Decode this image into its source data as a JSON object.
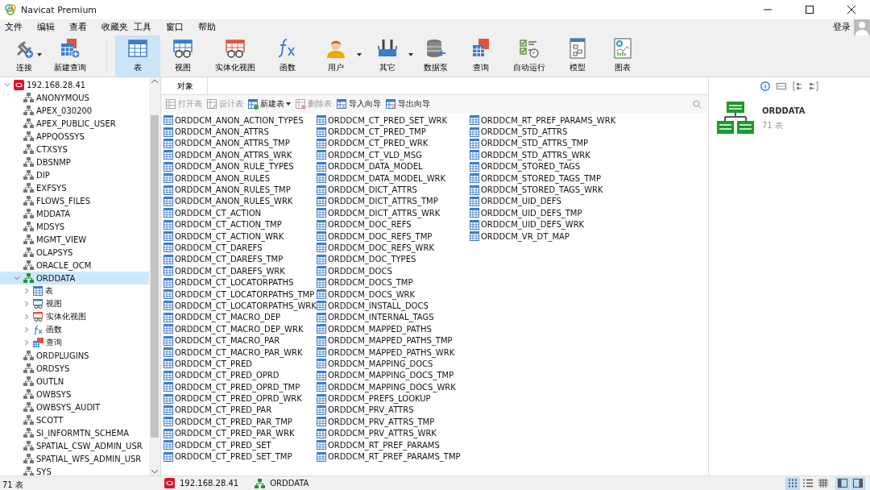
{
  "window": {
    "title": "Navicat Premium"
  },
  "menu": [
    "文件",
    "编辑",
    "查看",
    "收藏夹",
    "工具",
    "窗口",
    "帮助"
  ],
  "login": "登录",
  "toolbar": [
    {
      "label": "连接",
      "kind": "connect",
      "dropdown": true,
      "selected": false
    },
    {
      "label": "新建查询",
      "kind": "newquery",
      "dropdown": false,
      "selected": false
    },
    {
      "label": "表",
      "kind": "table",
      "dropdown": false,
      "selected": true
    },
    {
      "label": "视图",
      "kind": "view",
      "dropdown": false,
      "selected": false
    },
    {
      "label": "实体化视图",
      "kind": "matview",
      "dropdown": false,
      "selected": false
    },
    {
      "label": "函数",
      "kind": "function",
      "dropdown": false,
      "selected": false
    },
    {
      "label": "用户",
      "kind": "user",
      "dropdown": true,
      "selected": false
    },
    {
      "label": "其它",
      "kind": "tools",
      "dropdown": true,
      "selected": false
    },
    {
      "label": "数据泵",
      "kind": "pump",
      "dropdown": false,
      "selected": false
    },
    {
      "label": "查询",
      "kind": "query",
      "dropdown": false,
      "selected": false
    },
    {
      "label": "自动运行",
      "kind": "auto",
      "dropdown": false,
      "selected": false
    },
    {
      "label": "模型",
      "kind": "model",
      "dropdown": false,
      "selected": false
    },
    {
      "label": "图表",
      "kind": "chart",
      "dropdown": false,
      "selected": false
    }
  ],
  "tree": {
    "label": "192.168.28.41",
    "expanded": true,
    "children": [
      {
        "label": "ANONYMOUS",
        "kind": "schema",
        "selected": false
      },
      {
        "label": "APEX_030200",
        "kind": "schema",
        "selected": false
      },
      {
        "label": "APEX_PUBLIC_USER",
        "kind": "schema",
        "selected": false
      },
      {
        "label": "APPQOSSYS",
        "kind": "schema",
        "selected": false
      },
      {
        "label": "CTXSYS",
        "kind": "schema",
        "selected": false
      },
      {
        "label": "DBSNMP",
        "kind": "schema",
        "selected": false
      },
      {
        "label": "DIP",
        "kind": "schema",
        "selected": false
      },
      {
        "label": "EXFSYS",
        "kind": "schema",
        "selected": false
      },
      {
        "label": "FLOWS_FILES",
        "kind": "schema",
        "selected": false
      },
      {
        "label": "MDDATA",
        "kind": "schema",
        "selected": false
      },
      {
        "label": "MDSYS",
        "kind": "schema",
        "selected": false
      },
      {
        "label": "MGMT_VIEW",
        "kind": "schema",
        "selected": false
      },
      {
        "label": "OLAPSYS",
        "kind": "schema",
        "selected": false
      },
      {
        "label": "ORACLE_OCM",
        "kind": "schema",
        "selected": false
      },
      {
        "label": "ORDDATA",
        "kind": "open-schema",
        "selected": true,
        "expanded": true,
        "children": [
          {
            "label": "表",
            "kind": "table",
            "selected": false,
            "expanded": false
          },
          {
            "label": "视图",
            "kind": "view",
            "selected": false,
            "expanded": false
          },
          {
            "label": "实体化视图",
            "kind": "matview",
            "selected": false,
            "expanded": false
          },
          {
            "label": "函数",
            "kind": "function",
            "selected": false,
            "expanded": false
          },
          {
            "label": "查询",
            "kind": "query",
            "selected": false,
            "expanded": false
          }
        ]
      },
      {
        "label": "ORDPLUGINS",
        "kind": "schema",
        "selected": false
      },
      {
        "label": "ORDSYS",
        "kind": "schema",
        "selected": false
      },
      {
        "label": "OUTLN",
        "kind": "schema",
        "selected": false
      },
      {
        "label": "OWBSYS",
        "kind": "schema",
        "selected": false
      },
      {
        "label": "OWBSYS_AUDIT",
        "kind": "schema",
        "selected": false
      },
      {
        "label": "SCOTT",
        "kind": "schema",
        "selected": false
      },
      {
        "label": "SI_INFORMTN_SCHEMA",
        "kind": "schema",
        "selected": false
      },
      {
        "label": "SPATIAL_CSW_ADMIN_USR",
        "kind": "schema",
        "selected": false
      },
      {
        "label": "SPATIAL_WFS_ADMIN_USR",
        "kind": "schema",
        "selected": false
      },
      {
        "label": "SYS",
        "kind": "schema",
        "selected": false
      }
    ]
  },
  "tabs": [
    {
      "label": "对象",
      "selected": true
    }
  ],
  "object_toolbar": [
    {
      "label": "打开表",
      "kind": "open",
      "disabled": true,
      "dropdown": false
    },
    {
      "label": "设计表",
      "kind": "design",
      "disabled": true,
      "dropdown": false
    },
    {
      "label": "新建表",
      "kind": "new",
      "disabled": false,
      "dropdown": true
    },
    {
      "label": "删除表",
      "kind": "delete",
      "disabled": true,
      "dropdown": false
    },
    {
      "label": "导入向导",
      "kind": "import",
      "disabled": false,
      "dropdown": false
    },
    {
      "label": "导出向导",
      "kind": "export",
      "disabled": false,
      "dropdown": false
    }
  ],
  "objects": [
    "ORDDCM_ANON_ACTION_TYPES",
    "ORDDCM_ANON_ATTRS",
    "ORDDCM_ANON_ATTRS_TMP",
    "ORDDCM_ANON_ATTRS_WRK",
    "ORDDCM_ANON_RULE_TYPES",
    "ORDDCM_ANON_RULES",
    "ORDDCM_ANON_RULES_TMP",
    "ORDDCM_ANON_RULES_WRK",
    "ORDDCM_CT_ACTION",
    "ORDDCM_CT_ACTION_TMP",
    "ORDDCM_CT_ACTION_WRK",
    "ORDDCM_CT_DAREFS",
    "ORDDCM_CT_DAREFS_TMP",
    "ORDDCM_CT_DAREFS_WRK",
    "ORDDCM_CT_LOCATORPATHS",
    "ORDDCM_CT_LOCATORPATHS_TMP",
    "ORDDCM_CT_LOCATORPATHS_WRK",
    "ORDDCM_CT_MACRO_DEP",
    "ORDDCM_CT_MACRO_DEP_WRK",
    "ORDDCM_CT_MACRO_PAR",
    "ORDDCM_CT_MACRO_PAR_WRK",
    "ORDDCM_CT_PRED",
    "ORDDCM_CT_PRED_OPRD",
    "ORDDCM_CT_PRED_OPRD_TMP",
    "ORDDCM_CT_PRED_OPRD_WRK",
    "ORDDCM_CT_PRED_PAR",
    "ORDDCM_CT_PRED_PAR_TMP",
    "ORDDCM_CT_PRED_PAR_WRK",
    "ORDDCM_CT_PRED_SET",
    "ORDDCM_CT_PRED_SET_TMP",
    "ORDDCM_CT_PRED_SET_WRK",
    "ORDDCM_CT_PRED_TMP",
    "ORDDCM_CT_PRED_WRK",
    "ORDDCM_CT_VLD_MSG",
    "ORDDCM_DATA_MODEL",
    "ORDDCM_DATA_MODEL_WRK",
    "ORDDCM_DICT_ATTRS",
    "ORDDCM_DICT_ATTRS_TMP",
    "ORDDCM_DICT_ATTRS_WRK",
    "ORDDCM_DOC_REFS",
    "ORDDCM_DOC_REFS_TMP",
    "ORDDCM_DOC_REFS_WRK",
    "ORDDCM_DOC_TYPES",
    "ORDDCM_DOCS",
    "ORDDCM_DOCS_TMP",
    "ORDDCM_DOCS_WRK",
    "ORDDCM_INSTALL_DOCS",
    "ORDDCM_INTERNAL_TAGS",
    "ORDDCM_MAPPED_PATHS",
    "ORDDCM_MAPPED_PATHS_TMP",
    "ORDDCM_MAPPED_PATHS_WRK",
    "ORDDCM_MAPPING_DOCS",
    "ORDDCM_MAPPING_DOCS_TMP",
    "ORDDCM_MAPPING_DOCS_WRK",
    "ORDDCM_PREFS_LOOKUP",
    "ORDDCM_PRV_ATTRS",
    "ORDDCM_PRV_ATTRS_TMP",
    "ORDDCM_PRV_ATTRS_WRK",
    "ORDDCM_RT_PREF_PARAMS",
    "ORDDCM_RT_PREF_PARAMS_TMP",
    "ORDDCM_RT_PREF_PARAMS_WRK",
    "ORDDCM_STD_ATTRS",
    "ORDDCM_STD_ATTRS_TMP",
    "ORDDCM_STD_ATTRS_WRK",
    "ORDDCM_STORED_TAGS",
    "ORDDCM_STORED_TAGS_TMP",
    "ORDDCM_STORED_TAGS_WRK",
    "ORDDCM_UID_DEFS",
    "ORDDCM_UID_DEFS_TMP",
    "ORDDCM_UID_DEFS_WRK",
    "ORDDCM_VR_DT_MAP"
  ],
  "info_tabs": [
    {
      "kind": "info",
      "selected": true
    },
    {
      "kind": "ddl",
      "selected": false
    },
    {
      "kind": "deps",
      "selected": false
    },
    {
      "kind": "props",
      "selected": false
    }
  ],
  "info": {
    "name": "ORDDATA",
    "count": "71 表"
  },
  "status": {
    "count": "71 表",
    "connection": "192.168.28.41",
    "schema": "ORDDATA"
  },
  "view_modes": [
    {
      "kind": "grid",
      "selected": true
    },
    {
      "kind": "list",
      "selected": false
    },
    {
      "kind": "detail",
      "selected": false
    }
  ],
  "panel_toggles": [
    {
      "kind": "left",
      "selected": true
    },
    {
      "kind": "right",
      "selected": true
    }
  ]
}
